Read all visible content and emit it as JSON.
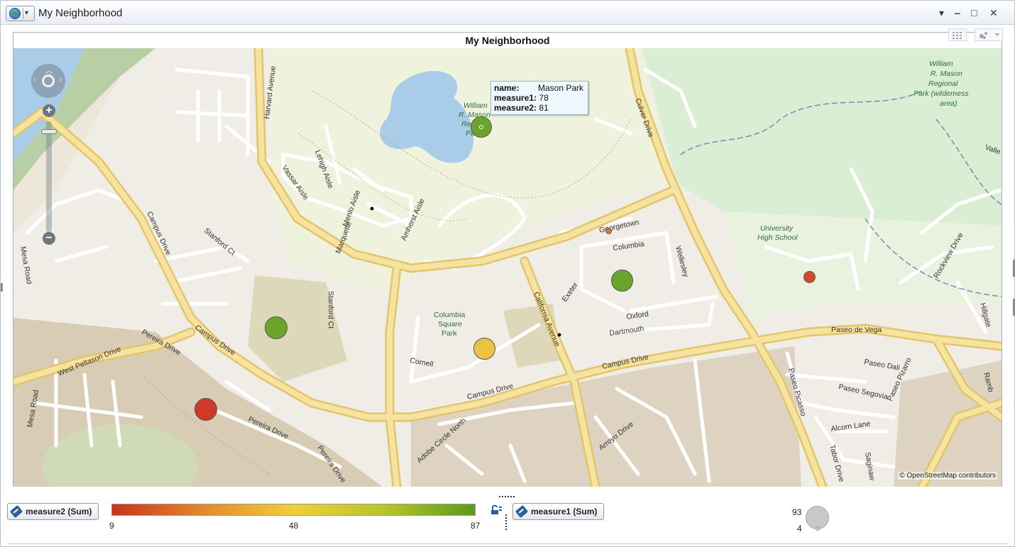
{
  "window": {
    "title": "My Neighborhood",
    "controls": [
      "▾",
      "‒",
      "□",
      "✕"
    ]
  },
  "panel": {
    "title": "My Neighborhood"
  },
  "map": {
    "attribution": "© OpenStreetMap contributors",
    "labels": [
      {
        "text": "Harvard Avenue",
        "name": "map-label-harvard-avenue"
      },
      {
        "text": "Lehigh Aisle",
        "name": "map-label-lehigh-aisle"
      },
      {
        "text": "Vassar Aisle",
        "name": "map-label-vassar-aisle"
      },
      {
        "text": "Menlo Aisle",
        "name": "map-label-menlo-aisle"
      },
      {
        "text": "Marquette",
        "name": "map-label-marquette"
      },
      {
        "text": "Amherst Aisle",
        "name": "map-label-amherst-aisle"
      },
      {
        "text": "Stanford Ct",
        "name": "map-label-stanford-ct"
      },
      {
        "text": "Stanford Ct",
        "name": "map-label-stanford-ct-2"
      },
      {
        "text": "Campus Drive",
        "name": "map-label-campus-drive"
      },
      {
        "text": "Campus Drive",
        "name": "map-label-campus-drive-2"
      },
      {
        "text": "Campus Drive",
        "name": "map-label-campus-drive-3"
      },
      {
        "text": "Campus Drive",
        "name": "map-label-campus-drive-4"
      },
      {
        "text": "Mesa Road",
        "name": "map-label-mesa-road"
      },
      {
        "text": "Mesa Road",
        "name": "map-label-mesa-road-2"
      },
      {
        "text": "West Peltason Drive",
        "name": "map-label-west-peltason"
      },
      {
        "text": "Pereira Drive",
        "name": "map-label-pereira-drive"
      },
      {
        "text": "Pereira Drive",
        "name": "map-label-pereira-drive-2"
      },
      {
        "text": "Pereira Drive",
        "name": "map-label-pereira-drive-3"
      },
      {
        "text": "Culver Drive",
        "name": "map-label-culver-drive"
      },
      {
        "text": "Georgetown",
        "name": "map-label-georgetown"
      },
      {
        "text": "Columbia",
        "name": "map-label-columbia"
      },
      {
        "text": "Wellesley",
        "name": "map-label-wellesley"
      },
      {
        "text": "Exeter",
        "name": "map-label-exeter"
      },
      {
        "text": "Oxford",
        "name": "map-label-oxford"
      },
      {
        "text": "Dartmouth",
        "name": "map-label-dartmouth"
      },
      {
        "text": "California Avenue",
        "name": "map-label-california-avenue"
      },
      {
        "text": "Cornell",
        "name": "map-label-cornell"
      },
      {
        "text": "Columbia",
        "name": "map-label-columbia-square-1"
      },
      {
        "text": "Square",
        "name": "map-label-columbia-square-2"
      },
      {
        "text": "Park",
        "name": "map-label-columbia-square-3"
      },
      {
        "text": "Adobe Circle North",
        "name": "map-label-adobe-circle"
      },
      {
        "text": "Arroyo Drive",
        "name": "map-label-arroyo-drive"
      },
      {
        "text": "University",
        "name": "map-label-university-1"
      },
      {
        "text": "High School",
        "name": "map-label-university-2"
      },
      {
        "text": "Paseo de Vega",
        "name": "map-label-paseo-de-vega"
      },
      {
        "text": "Paseo Dali",
        "name": "map-label-paseo-dali"
      },
      {
        "text": "Paseo Pizarro",
        "name": "map-label-paseo-pizarro"
      },
      {
        "text": "Paseo Picasso",
        "name": "map-label-paseo-picasso"
      },
      {
        "text": "Paseo Segovia",
        "name": "map-label-paseo-segovia"
      },
      {
        "text": "Alcorn Lane",
        "name": "map-label-alcorn-lane"
      },
      {
        "text": "Tabor Drive",
        "name": "map-label-tabor-drive"
      },
      {
        "text": "Saginaw",
        "name": "map-label-saginaw"
      },
      {
        "text": "Rockview Drive",
        "name": "map-label-rockview-drive"
      },
      {
        "text": "Hillgate",
        "name": "map-label-hillgate"
      },
      {
        "text": "Valle",
        "name": "map-label-valle"
      },
      {
        "text": "Ramb",
        "name": "map-label-ramb"
      },
      {
        "text": "William",
        "name": "map-label-mason-park-1"
      },
      {
        "text": "R. Mason",
        "name": "map-label-mason-park-2"
      },
      {
        "text": "Regional",
        "name": "map-label-mason-park-3"
      },
      {
        "text": "Park (wilderness",
        "name": "map-label-mason-park-4"
      },
      {
        "text": "area)",
        "name": "map-label-mason-park-5"
      },
      {
        "text": "William",
        "name": "map-label-mason-lake-1"
      },
      {
        "text": "R. Mason",
        "name": "map-label-mason-lake-2"
      },
      {
        "text": "Regio",
        "name": "map-label-mason-lake-3"
      },
      {
        "text": "Par",
        "name": "map-label-mason-lake-4"
      }
    ],
    "markers": [
      {
        "name": "marker-mason-park",
        "color": "#6aa42a"
      },
      {
        "name": "marker-columbia-north",
        "color": "#6aa42a"
      },
      {
        "name": "marker-campus-west",
        "color": "#6aa42a"
      },
      {
        "name": "marker-columbia-square",
        "color": "#ecc340"
      },
      {
        "name": "marker-pereira",
        "color": "#d0382a"
      },
      {
        "name": "marker-university-hs",
        "color": "#d24a2c"
      },
      {
        "name": "marker-georgetown",
        "color": "#d9772f"
      }
    ]
  },
  "tooltip": {
    "name_key": "name:",
    "name_value": "Mason Park",
    "m1_key": "measure1:",
    "m1_value": "78",
    "m2_key": "measure2:",
    "m2_value": "81"
  },
  "legend": {
    "color_measure": "measure2 (Sum)",
    "size_measure": "measure1 (Sum)",
    "color_min": "9",
    "color_mid": "48",
    "color_max": "87",
    "size_max": "93",
    "size_min": "4"
  }
}
